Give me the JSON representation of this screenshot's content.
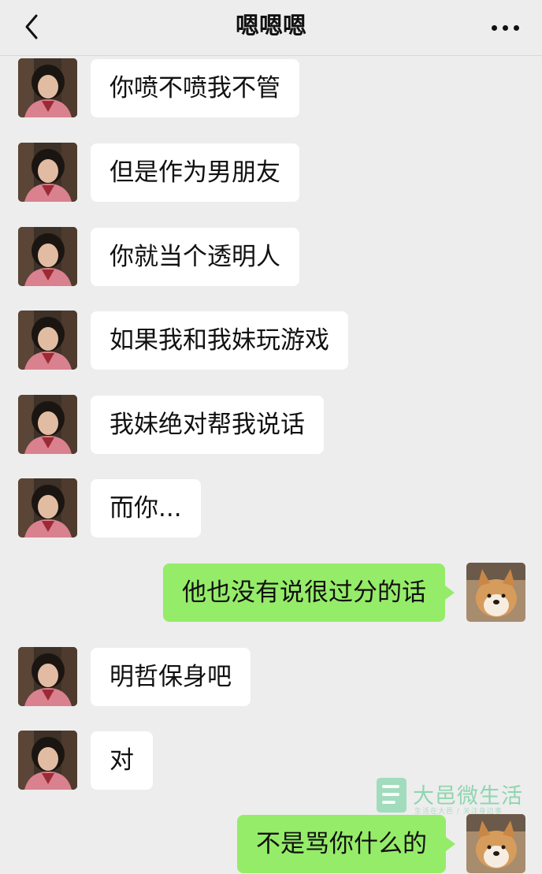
{
  "header": {
    "title": "嗯嗯嗯"
  },
  "messages": [
    {
      "side": "left",
      "text": "你喷不喷我不管"
    },
    {
      "side": "left",
      "text": "但是作为男朋友"
    },
    {
      "side": "left",
      "text": "你就当个透明人"
    },
    {
      "side": "left",
      "text": "如果我和我妹玩游戏"
    },
    {
      "side": "left",
      "text": "我妹绝对帮我说话"
    },
    {
      "side": "left",
      "text": "而你..."
    },
    {
      "side": "right",
      "text": "他也没有说很过分的话"
    },
    {
      "side": "left",
      "text": "明哲保身吧"
    },
    {
      "side": "left",
      "text": "对"
    },
    {
      "side": "right",
      "text": "不是骂你什么的"
    }
  ],
  "watermark": {
    "name": "大邑微生活",
    "tagline": "生活在大邑 / 关注身边事"
  },
  "colors": {
    "background": "#ededed",
    "sent_bubble": "#95ec69",
    "received_bubble": "#ffffff"
  },
  "icons": {
    "back": "chevron-left-icon",
    "more": "more-dots-icon"
  }
}
